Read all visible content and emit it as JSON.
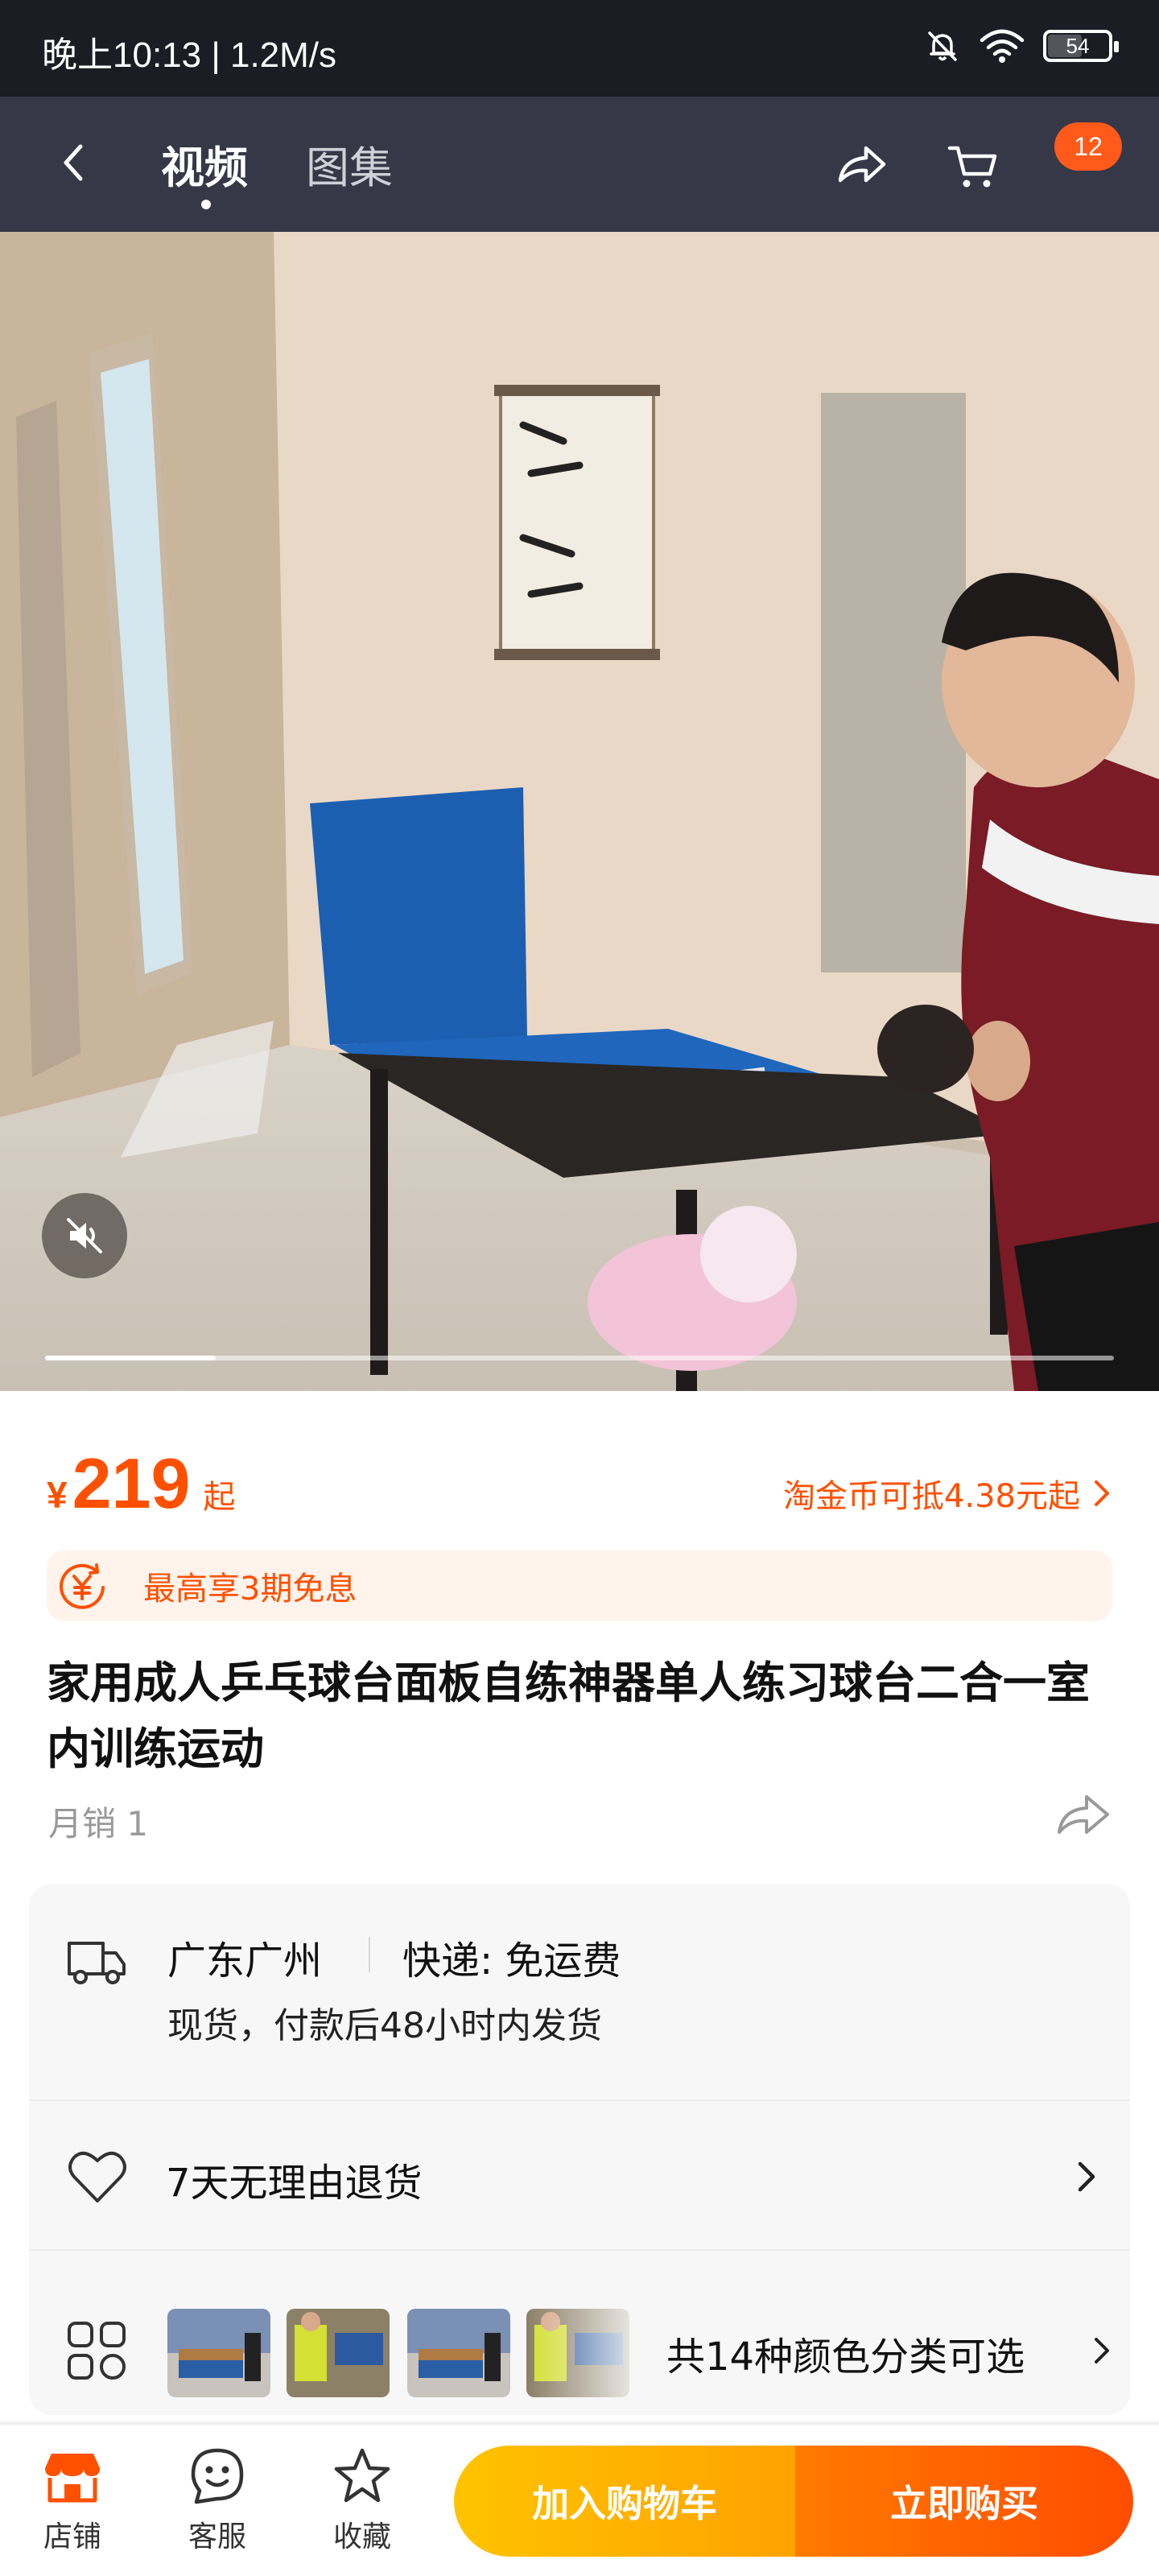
{
  "status_bar": {
    "time": "晚上10:13 | 1.2M/s",
    "battery": "54",
    "icons": [
      "bell-off-icon",
      "wifi-icon",
      "battery-icon"
    ]
  },
  "nav": {
    "tabs": [
      {
        "label": "视频",
        "active": true
      },
      {
        "label": "图集",
        "active": false
      }
    ],
    "cart_badge": "12",
    "icons": [
      "back-icon",
      "share-icon",
      "cart-icon"
    ]
  },
  "media": {
    "progress": 0.16,
    "muted": true
  },
  "price": {
    "currency": "¥",
    "value": "219",
    "suffix": "起"
  },
  "coin_deduct": "淘金币可抵4.38元起",
  "installment": "最高享3期免息",
  "product": {
    "title": "家用成人乒乓球台面板自练神器单人练习球台二合一室内训练运动",
    "monthly_sales": "月销 1"
  },
  "shipping": {
    "location": "广东广州",
    "method": "快递: 免运费",
    "note": "现货，付款后48小时内发货"
  },
  "returns": {
    "text": "7天无理由退货"
  },
  "variants": {
    "text": "共14种颜色分类可选"
  },
  "bottom_bar": {
    "store": "店铺",
    "service": "客服",
    "favorite": "收藏",
    "add_to_cart": "加入购物车",
    "buy_now": "立即购买"
  },
  "colors": {
    "accent": "#ff5000",
    "cart_button": "#ffa200",
    "buy_button": "#ff4d00"
  }
}
